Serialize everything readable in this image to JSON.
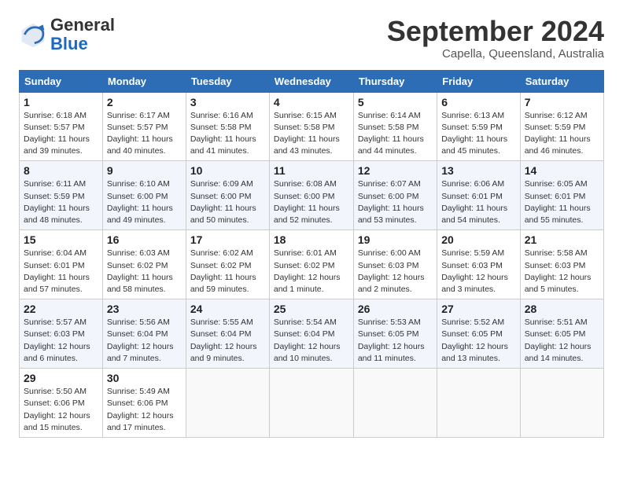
{
  "header": {
    "logo_general": "General",
    "logo_blue": "Blue",
    "month_title": "September 2024",
    "subtitle": "Capella, Queensland, Australia"
  },
  "days_of_week": [
    "Sunday",
    "Monday",
    "Tuesday",
    "Wednesday",
    "Thursday",
    "Friday",
    "Saturday"
  ],
  "weeks": [
    [
      {
        "day": 1,
        "sunrise": "6:18 AM",
        "sunset": "5:57 PM",
        "daylight": "11 hours and 39 minutes."
      },
      {
        "day": 2,
        "sunrise": "6:17 AM",
        "sunset": "5:57 PM",
        "daylight": "11 hours and 40 minutes."
      },
      {
        "day": 3,
        "sunrise": "6:16 AM",
        "sunset": "5:58 PM",
        "daylight": "11 hours and 41 minutes."
      },
      {
        "day": 4,
        "sunrise": "6:15 AM",
        "sunset": "5:58 PM",
        "daylight": "11 hours and 43 minutes."
      },
      {
        "day": 5,
        "sunrise": "6:14 AM",
        "sunset": "5:58 PM",
        "daylight": "11 hours and 44 minutes."
      },
      {
        "day": 6,
        "sunrise": "6:13 AM",
        "sunset": "5:59 PM",
        "daylight": "11 hours and 45 minutes."
      },
      {
        "day": 7,
        "sunrise": "6:12 AM",
        "sunset": "5:59 PM",
        "daylight": "11 hours and 46 minutes."
      }
    ],
    [
      {
        "day": 8,
        "sunrise": "6:11 AM",
        "sunset": "5:59 PM",
        "daylight": "11 hours and 48 minutes."
      },
      {
        "day": 9,
        "sunrise": "6:10 AM",
        "sunset": "6:00 PM",
        "daylight": "11 hours and 49 minutes."
      },
      {
        "day": 10,
        "sunrise": "6:09 AM",
        "sunset": "6:00 PM",
        "daylight": "11 hours and 50 minutes."
      },
      {
        "day": 11,
        "sunrise": "6:08 AM",
        "sunset": "6:00 PM",
        "daylight": "11 hours and 52 minutes."
      },
      {
        "day": 12,
        "sunrise": "6:07 AM",
        "sunset": "6:00 PM",
        "daylight": "11 hours and 53 minutes."
      },
      {
        "day": 13,
        "sunrise": "6:06 AM",
        "sunset": "6:01 PM",
        "daylight": "11 hours and 54 minutes."
      },
      {
        "day": 14,
        "sunrise": "6:05 AM",
        "sunset": "6:01 PM",
        "daylight": "11 hours and 55 minutes."
      }
    ],
    [
      {
        "day": 15,
        "sunrise": "6:04 AM",
        "sunset": "6:01 PM",
        "daylight": "11 hours and 57 minutes."
      },
      {
        "day": 16,
        "sunrise": "6:03 AM",
        "sunset": "6:02 PM",
        "daylight": "11 hours and 58 minutes."
      },
      {
        "day": 17,
        "sunrise": "6:02 AM",
        "sunset": "6:02 PM",
        "daylight": "11 hours and 59 minutes."
      },
      {
        "day": 18,
        "sunrise": "6:01 AM",
        "sunset": "6:02 PM",
        "daylight": "12 hours and 1 minute."
      },
      {
        "day": 19,
        "sunrise": "6:00 AM",
        "sunset": "6:03 PM",
        "daylight": "12 hours and 2 minutes."
      },
      {
        "day": 20,
        "sunrise": "5:59 AM",
        "sunset": "6:03 PM",
        "daylight": "12 hours and 3 minutes."
      },
      {
        "day": 21,
        "sunrise": "5:58 AM",
        "sunset": "6:03 PM",
        "daylight": "12 hours and 5 minutes."
      }
    ],
    [
      {
        "day": 22,
        "sunrise": "5:57 AM",
        "sunset": "6:03 PM",
        "daylight": "12 hours and 6 minutes."
      },
      {
        "day": 23,
        "sunrise": "5:56 AM",
        "sunset": "6:04 PM",
        "daylight": "12 hours and 7 minutes."
      },
      {
        "day": 24,
        "sunrise": "5:55 AM",
        "sunset": "6:04 PM",
        "daylight": "12 hours and 9 minutes."
      },
      {
        "day": 25,
        "sunrise": "5:54 AM",
        "sunset": "6:04 PM",
        "daylight": "12 hours and 10 minutes."
      },
      {
        "day": 26,
        "sunrise": "5:53 AM",
        "sunset": "6:05 PM",
        "daylight": "12 hours and 11 minutes."
      },
      {
        "day": 27,
        "sunrise": "5:52 AM",
        "sunset": "6:05 PM",
        "daylight": "12 hours and 13 minutes."
      },
      {
        "day": 28,
        "sunrise": "5:51 AM",
        "sunset": "6:05 PM",
        "daylight": "12 hours and 14 minutes."
      }
    ],
    [
      {
        "day": 29,
        "sunrise": "5:50 AM",
        "sunset": "6:06 PM",
        "daylight": "12 hours and 15 minutes."
      },
      {
        "day": 30,
        "sunrise": "5:49 AM",
        "sunset": "6:06 PM",
        "daylight": "12 hours and 17 minutes."
      },
      null,
      null,
      null,
      null,
      null
    ]
  ]
}
